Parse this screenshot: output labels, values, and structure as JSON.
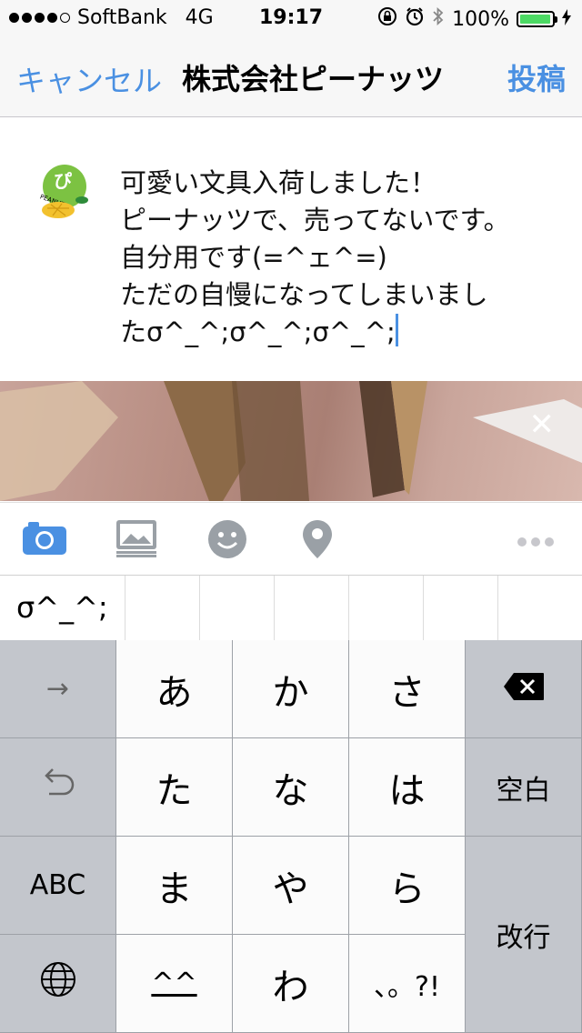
{
  "status_bar": {
    "carrier": "SoftBank",
    "network": "4G",
    "time": "19:17",
    "battery_percent": "100%",
    "signal_bars": 4
  },
  "nav": {
    "cancel_label": "キャンセル",
    "title": "株式会社ピーナッツ",
    "post_label": "投稿"
  },
  "post": {
    "text": "可愛い文具入荷しました！\nピーナッツで、売ってないです。\n自分用です(=^ェ^=)\nただの自慢になってしまいまし\nたσ^_^;σ^_^;σ^_^;",
    "avatar_label": "PEANUTS"
  },
  "photo": {
    "remove_icon": "close-icon"
  },
  "toolbar": {
    "icons": [
      "camera-icon",
      "photo-library-icon",
      "emoji-icon",
      "location-pin-icon",
      "more-icon"
    ]
  },
  "candidates": [
    "σ^_^;",
    "",
    "",
    "",
    "",
    ""
  ],
  "keyboard": {
    "row1": [
      "→",
      "あ",
      "か",
      "さ",
      "⌫"
    ],
    "row2": [
      "↶",
      "た",
      "な",
      "は",
      "空白"
    ],
    "row3": [
      "ABC",
      "ま",
      "や",
      "ら",
      "改行"
    ],
    "row4": [
      "🌐",
      "^^",
      "わ",
      "、。?!"
    ]
  },
  "colors": {
    "accent": "#4a90e2",
    "battery": "#4cd964",
    "keyboard_bg": "#c3c6cc"
  }
}
